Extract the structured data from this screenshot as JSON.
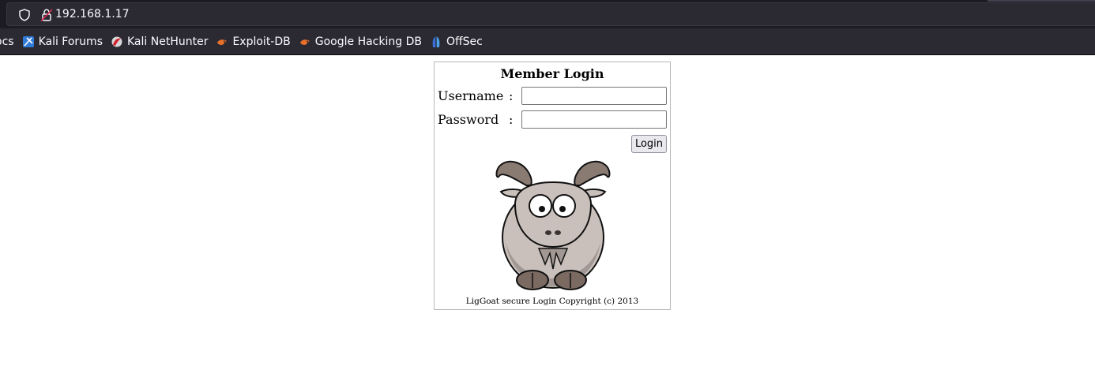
{
  "browser": {
    "url": "192.168.1.17",
    "bookmarks": [
      {
        "label": "ocs",
        "icon": "none"
      },
      {
        "label": "Kali Forums",
        "icon": "kali-forums-icon"
      },
      {
        "label": "Kali NetHunter",
        "icon": "kali-nethunter-icon"
      },
      {
        "label": "Exploit-DB",
        "icon": "exploit-db-icon"
      },
      {
        "label": "Google Hacking DB",
        "icon": "exploit-db-icon"
      },
      {
        "label": "OffSec",
        "icon": "offsec-icon"
      }
    ],
    "colors": {
      "toolbar": "#2b2a33",
      "urlbar": "#1c1b22",
      "text": "#fbfbfe"
    }
  },
  "login": {
    "title": "Member Login",
    "username_label": "Username",
    "password_label": "Password",
    "separator": ":",
    "username_value": "",
    "password_value": "",
    "button_label": "Login",
    "image": "goat-cartoon",
    "copyright": "LigGoat secure Login Copyright (c) 2013"
  }
}
